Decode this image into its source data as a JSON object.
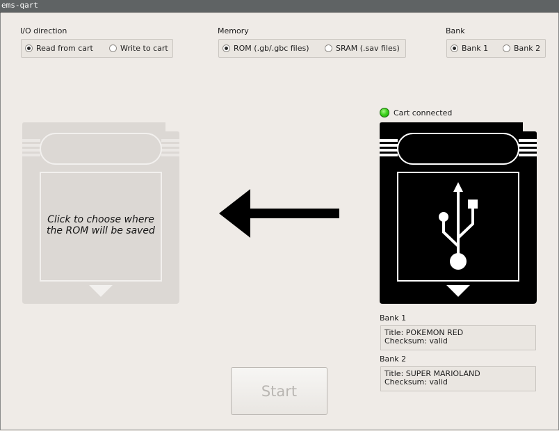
{
  "window": {
    "title": "ems-qart"
  },
  "io_direction": {
    "label": "I/O direction",
    "options": [
      {
        "label": "Read from cart",
        "selected": true
      },
      {
        "label": "Write to cart",
        "selected": false
      }
    ]
  },
  "memory": {
    "label": "Memory",
    "options": [
      {
        "label": "ROM (.gb/.gbc files)",
        "selected": true
      },
      {
        "label": "SRAM (.sav files)",
        "selected": false
      }
    ]
  },
  "bank_select": {
    "label": "Bank",
    "options": [
      {
        "label": "Bank 1",
        "selected": true
      },
      {
        "label": "Bank 2",
        "selected": false
      }
    ]
  },
  "destination": {
    "hint_line1": "Click to choose where",
    "hint_line2": "the ROM will be saved"
  },
  "source": {
    "status": "Cart connected",
    "status_color": "#3fd41e",
    "icon": "usb-icon"
  },
  "banks": [
    {
      "heading": "Bank 1",
      "title_line": "Title: POKEMON RED",
      "checksum_line": "Checksum: valid"
    },
    {
      "heading": "Bank 2",
      "title_line": "Title: SUPER MARIOLAND",
      "checksum_line": "Checksum: valid"
    }
  ],
  "actions": {
    "start_label": "Start",
    "enabled": false
  },
  "colors": {
    "background": "#efebe7",
    "cart_disabled": "#dcd8d4",
    "cart_active": "#000000",
    "arrow": "#000000"
  }
}
